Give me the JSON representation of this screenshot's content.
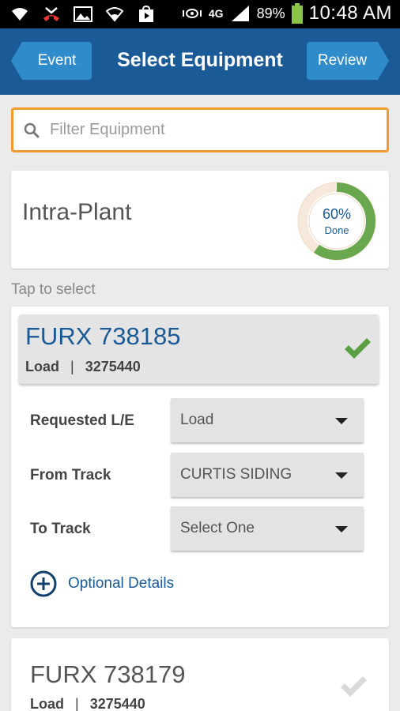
{
  "status_bar": {
    "left_icons": [
      "wifi-icon",
      "missed-call-icon",
      "image-icon",
      "wifi-alt-icon",
      "play-store-icon"
    ],
    "right_icons": [
      "vibrate-icon",
      "network-4g-icon",
      "signal-icon",
      "battery-icon"
    ],
    "network": "4G",
    "battery_pct": "89%",
    "time": "10:48 AM"
  },
  "header": {
    "back_label": "Event",
    "title": "Select Equipment",
    "next_label": "Review",
    "color": "#1a5a96",
    "button_color": "#2f8bc9"
  },
  "filter": {
    "placeholder": "Filter Equipment",
    "value": "",
    "border_color": "#f29a2e"
  },
  "summary": {
    "title": "Intra-Plant",
    "progress_pct": 60,
    "progress_text": "60%",
    "progress_label": "Done",
    "progress_color": "#6aa84f"
  },
  "hint": "Tap to select",
  "equipment": [
    {
      "id": "FURX 738185",
      "type": "Load",
      "separator": "|",
      "number": "3275440",
      "selected": true,
      "fields": [
        {
          "label": "Requested L/E",
          "value": "Load"
        },
        {
          "label": "From Track",
          "value": "CURTIS SIDING"
        },
        {
          "label": "To Track",
          "value": "Select One"
        }
      ],
      "optional_label": "Optional Details"
    },
    {
      "id": "FURX 738179",
      "type": "Load",
      "separator": "|",
      "number": "3275440",
      "selected": false
    }
  ]
}
